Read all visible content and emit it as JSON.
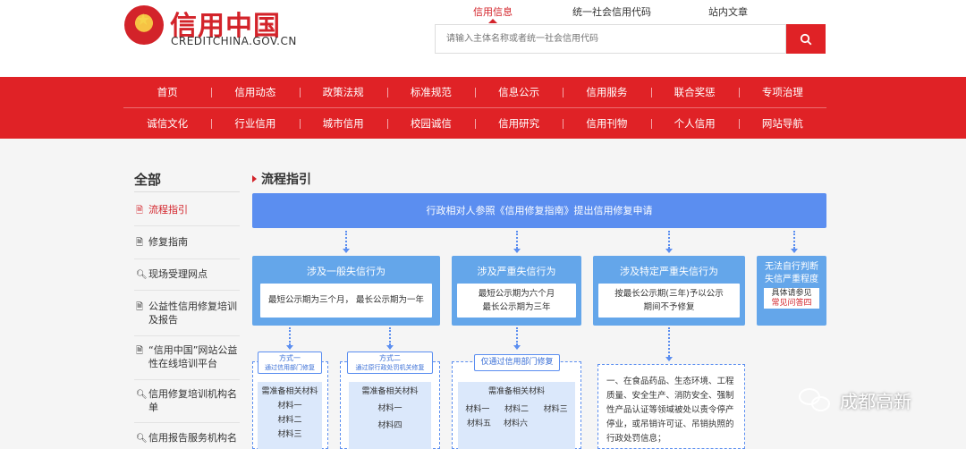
{
  "header": {
    "logo_title": "信用中国",
    "logo_url": "CREDITCHINA.GOV.CN",
    "search_tabs": [
      "信用信息",
      "统一社会信用代码",
      "站内文章"
    ],
    "search_placeholder": "请输入主体名称或者统一社会信用代码"
  },
  "nav": {
    "row1": [
      "首页",
      "信用动态",
      "政策法规",
      "标准规范",
      "信息公示",
      "信用服务",
      "联合奖惩",
      "专项治理"
    ],
    "row2": [
      "诚信文化",
      "行业信用",
      "城市信用",
      "校园诚信",
      "信用研究",
      "信用刊物",
      "个人信用",
      "网站导航"
    ]
  },
  "sidebar": {
    "title": "全部",
    "items": [
      {
        "icon": "document-icon",
        "label": "流程指引"
      },
      {
        "icon": "document-icon",
        "label": "修复指南"
      },
      {
        "icon": "search-icon",
        "label": "现场受理网点"
      },
      {
        "icon": "document-icon",
        "label": "公益性信用修复培训及报告"
      },
      {
        "icon": "document-icon",
        "label": "“信用中国”网站公益性在线培训平台"
      },
      {
        "icon": "search-icon",
        "label": "信用修复培训机构名单"
      },
      {
        "icon": "search-icon",
        "label": "信用报告服务机构名"
      }
    ]
  },
  "main": {
    "title": "流程指引",
    "banner": "行政相对人参照《信用修复指南》提出信用修复申请",
    "boxes": [
      {
        "head": "涉及一般失信行为",
        "body": [
          "最短公示期为三个月， 最长公示期为一年"
        ]
      },
      {
        "head": "涉及严重失信行为",
        "body": [
          "最短公示期为六个月",
          "最长公示期为三年"
        ]
      },
      {
        "head": "涉及特定严重失信行为",
        "body": [
          "按最长公示期(三年)予以公示",
          "期间不予修复"
        ]
      }
    ],
    "side_box": {
      "head": [
        "无法自行判断",
        "失信严重程度"
      ],
      "body": [
        "具体请参见"
      ],
      "link": "常见问答四"
    },
    "methods": [
      {
        "lines": [
          "方式一",
          "通过信用部门修复"
        ]
      },
      {
        "lines": [
          "方式二",
          "通过原行政处罚机关修复"
        ]
      }
    ],
    "only_label": "仅通过信用部门修复",
    "materials": {
      "m1": {
        "head": "需准备相关材料",
        "items": [
          "材料一",
          "材料二",
          "材料三"
        ]
      },
      "m2": {
        "head": "需准备相关材料",
        "items": [
          "材料一",
          "材料四"
        ]
      },
      "m3": {
        "head": "需准备相关材料",
        "rows": [
          [
            "材料一",
            "材料二",
            "材料三"
          ],
          [
            "材料五",
            "材料六"
          ]
        ]
      }
    },
    "list_text": "一、在食品药品、生态环境、工程质量、安全生产、消防安全、强制性产品认证等领域被处以责令停产停业，或吊销许可证、吊销执照的行政处罚信息；"
  },
  "watermark": "成都高新",
  "colors": {
    "brand_red": "#e02226",
    "banner_blue": "#5b8ef0",
    "box_blue": "#64a6ea",
    "material_bg": "#dbe8fb"
  }
}
